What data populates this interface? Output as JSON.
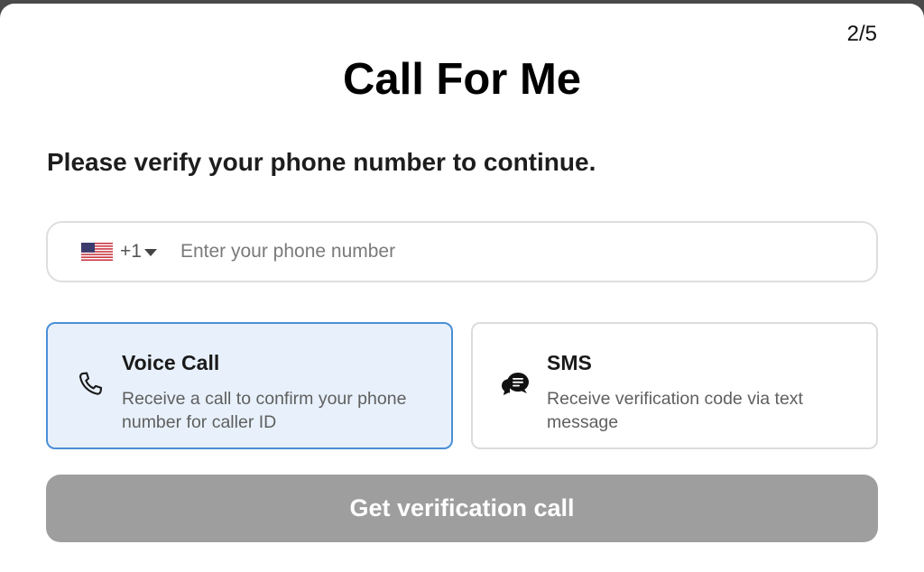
{
  "dialog": {
    "step": "2/5",
    "title": "Call For Me",
    "subtitle": "Please verify your phone number to continue."
  },
  "phone": {
    "country_flag": "us-flag-icon",
    "country_code": "+1",
    "placeholder": "Enter your phone number",
    "value": ""
  },
  "options": {
    "voice": {
      "icon": "phone-icon",
      "title": "Voice Call",
      "description": "Receive a call to confirm your phone number for caller ID",
      "selected": true
    },
    "sms": {
      "icon": "chat-bubbles-icon",
      "title": "SMS",
      "description": "Receive verification code via text message",
      "selected": false
    }
  },
  "submit": {
    "label": "Get verification call",
    "disabled": true
  },
  "colors": {
    "selected_bg": "#e8f1fb",
    "selected_border": "#4a8fd6",
    "button_disabled": "#9e9e9e"
  }
}
